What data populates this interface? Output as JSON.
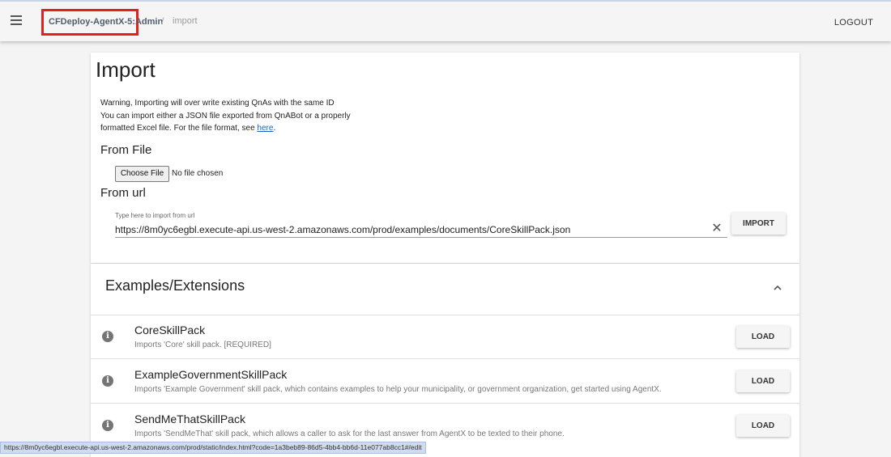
{
  "header": {
    "app_name": "CFDeploy-AgentX-5:Admin",
    "separator": "/",
    "page_crumb": "import",
    "logout_label": "LOGOUT"
  },
  "import_card": {
    "title": "Import",
    "warning_line1": "Warning, Importing will over write existing QnAs with the same ID",
    "warning_line2": "You can import either a JSON file exported from QnABot or a properly",
    "warning_line3_prefix": "formatted Excel file. For the file format, see ",
    "warning_link": "here",
    "warning_line3_suffix": ".",
    "from_file_heading": "From File",
    "choose_file_label": "Choose File",
    "no_file_text": "No file chosen",
    "from_url_heading": "From url",
    "url_label": "Type here to import from url",
    "url_value": "https://8m0yc6egbl.execute-api.us-west-2.amazonaws.com/prod/examples/documents/CoreSkillPack.json",
    "import_label": "IMPORT"
  },
  "examples": {
    "title": "Examples/Extensions",
    "items": [
      {
        "name": "CoreSkillPack",
        "description": "Imports 'Core' skill pack. [REQUIRED]",
        "load_label": "LOAD"
      },
      {
        "name": "ExampleGovernmentSkillPack",
        "description": "Imports 'Example Government' skill pack, which contains examples to help your municipality, or government organization, get started using AgentX.",
        "load_label": "LOAD"
      },
      {
        "name": "SendMeThatSkillPack",
        "description": "Imports 'SendMeThat' skill pack, which allows a caller to ask for the last answer from AgentX to be texted to their phone.",
        "load_label": "LOAD"
      }
    ]
  },
  "status_bar": {
    "url": "https://8m0yc6egbl.execute-api.us-west-2.amazonaws.com/prod/static/index.html?code=1a3beb89-86d5-4bb4-bb6d-11e077ab8cc1#/edit"
  },
  "colors": {
    "highlight_border": "#e3201b",
    "link": "#1565c0",
    "status_bar_bg": "#cfdcf0"
  }
}
